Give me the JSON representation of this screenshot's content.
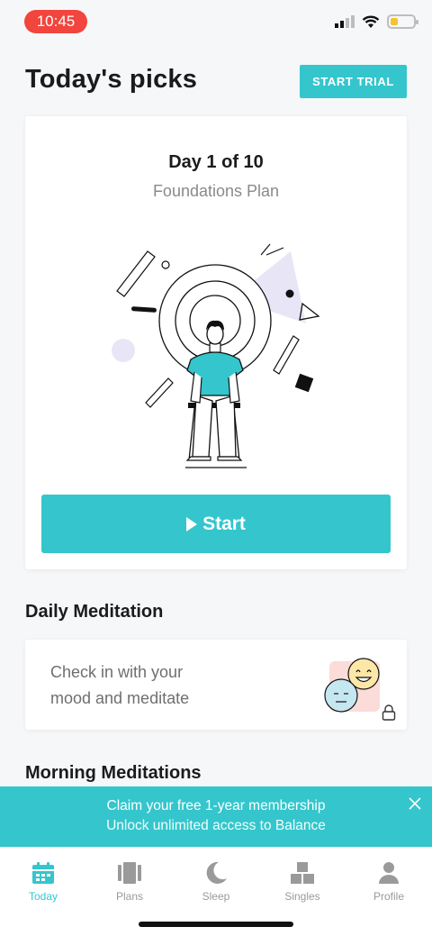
{
  "status_bar": {
    "time": "10:45"
  },
  "header": {
    "title": "Today's picks",
    "trial_label": "START TRIAL"
  },
  "pick_card": {
    "day_label": "Day 1 of 10",
    "plan_name": "Foundations Plan",
    "start_label": "Start"
  },
  "daily": {
    "section_title": "Daily Meditation",
    "description_line1": "Check in with your",
    "description_line2": "mood and meditate"
  },
  "morning": {
    "section_title": "Morning Meditations"
  },
  "banner": {
    "line1": "Claim your free 1-year membership",
    "line2": "Unlock unlimited access to Balance"
  },
  "tabs": [
    {
      "label": "Today",
      "icon": "calendar-icon",
      "active": true
    },
    {
      "label": "Plans",
      "icon": "plans-icon",
      "active": false
    },
    {
      "label": "Sleep",
      "icon": "moon-icon",
      "active": false
    },
    {
      "label": "Singles",
      "icon": "blocks-icon",
      "active": false
    },
    {
      "label": "Profile",
      "icon": "person-icon",
      "active": false
    }
  ],
  "colors": {
    "accent": "#34c6cc",
    "time_pill": "#f2453d"
  }
}
